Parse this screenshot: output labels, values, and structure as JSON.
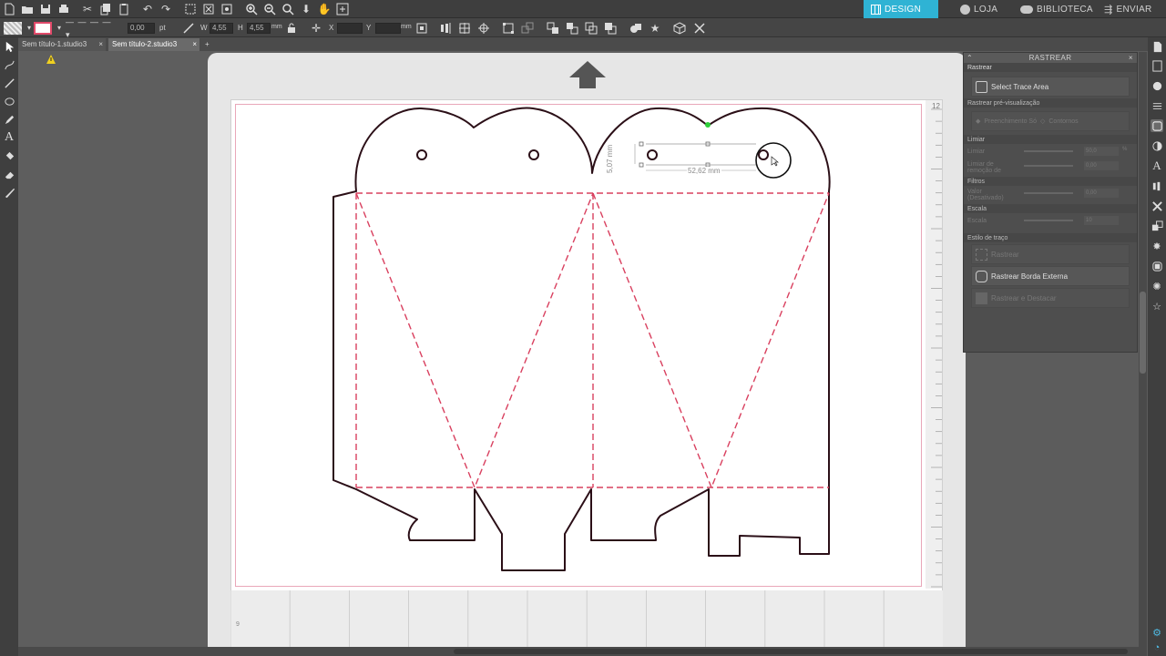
{
  "topbar": {
    "stroke_width": "0,00",
    "stroke_unit": "pt",
    "w_label": "W",
    "w_value": "4,55",
    "h_label": "H",
    "h_value": "4,55",
    "size_unit": "mm",
    "x_label": "X",
    "y_label": "Y",
    "pos_unit": "mm",
    "nav": [
      {
        "label": "DESIGN",
        "icon": "grid-icon",
        "active": true
      },
      {
        "label": "LOJA",
        "icon": "globe-icon",
        "active": false
      },
      {
        "label": "BIBLIOTECA",
        "icon": "cloud-icon",
        "active": false
      },
      {
        "label": "ENVIAR",
        "icon": "send-icon",
        "active": false
      }
    ]
  },
  "tabs": [
    {
      "label": "Sem título-1.studio3",
      "active": false
    },
    {
      "label": "Sem título-2.studio3",
      "active": true
    }
  ],
  "canvas": {
    "ruler_right_number": "12",
    "grid_corner_number": "9",
    "dim_width": "52,62 mm",
    "dim_height": "5,07 mm"
  },
  "panel": {
    "title": "RASTREAR",
    "subtitle": "Rastrear",
    "select_trace_area": "Select Trace Area",
    "preview_label": "Rastrear pré-visualização",
    "preview_fill": "Preenchimento Só",
    "preview_contours": "Contornos",
    "threshold_section": "Limiar",
    "threshold_label": "Limiar",
    "threshold_value": "50,0",
    "threshold_unit": "%",
    "removal_label": "Limiar de remoção de",
    "removal_value": "0,00",
    "filters_section": "Filtros",
    "filter_value_label": "Valor (Desativado)",
    "filter_value": "0,00",
    "scale_section": "Escala",
    "scale_label": "Escala",
    "scale_value": "10",
    "style_section": "Estilo de traço",
    "trace_btn": "Rastrear",
    "trace_outer_btn": "Rastrear Borda Externa",
    "trace_detach_btn": "Rastrear e Destacar"
  },
  "colors": {
    "accent": "#2fb3d4",
    "cut_line": "#2b0f17",
    "score_line": "#d9405f"
  }
}
